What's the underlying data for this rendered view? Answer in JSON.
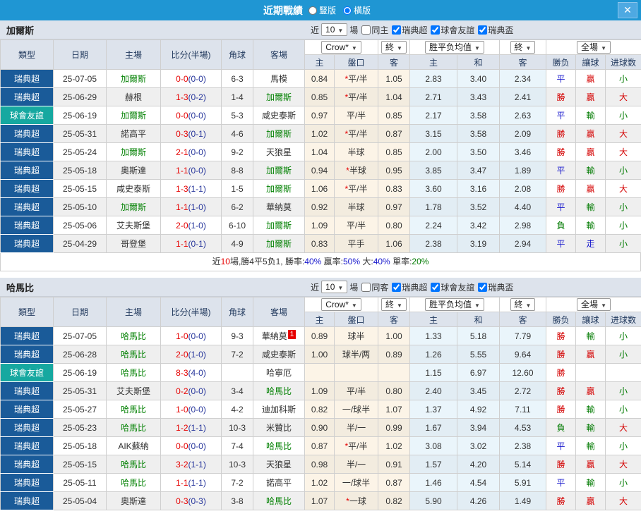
{
  "title_bar": {
    "title": "近期戰績",
    "vertical_label": "豎版",
    "vertical_selected": false,
    "horizontal_label": "橫版",
    "horizontal_selected": true,
    "close_label": "✕"
  },
  "table_header": {
    "left_columns": [
      "類型",
      "日期",
      "主場",
      "比分(半場)",
      "角球",
      "客場"
    ],
    "odds_company_dropdown": "Crow*",
    "final_dropdown_1": "終",
    "avg_dropdown": "胜平负均值",
    "final_dropdown_2": "終",
    "scope_dropdown": "全場",
    "odds_sub": [
      "主",
      "盤口",
      "客"
    ],
    "avg_sub": [
      "主",
      "和",
      "客"
    ],
    "result_sub": [
      "勝负",
      "讓球",
      "进球数"
    ]
  },
  "colors": {
    "titlebar": "#1f96d3",
    "league": {
      "瑞典超": "#1a5b99",
      "球會友誼": "#16a8a0"
    },
    "result": {
      "勝": "#d40000",
      "負": "#007a00",
      "平": "#1616cc",
      "贏": "#d40000",
      "輸": "#007a00",
      "走": "#1616cc",
      "大": "#d40000",
      "小": "#007a00"
    },
    "score_fulltime": "#e60000",
    "score_halftime": "#26359b",
    "self_team": "#008000",
    "red_card_badge": "#e60000"
  },
  "sections": [
    {
      "team": "加爾斯",
      "filter": {
        "near_label": "近",
        "count": "10",
        "games_label": "場",
        "same_label": "同主",
        "same_checked": false,
        "leagues": [
          {
            "label": "瑞典超",
            "checked": true
          },
          {
            "label": "球會友誼",
            "checked": true
          },
          {
            "label": "瑞典盃",
            "checked": true
          }
        ]
      },
      "rows": [
        {
          "type": "瑞典超",
          "date": "25-07-05",
          "home": "加爾斯",
          "home_self": true,
          "score_ft": "0-0",
          "score_ht": "(0-0)",
          "corner": "6-3",
          "away": "馬模",
          "away_self": false,
          "away_badge": "",
          "odds": {
            "home": "0.84",
            "star": "*",
            "handicap": "平/半",
            "away": "1.05"
          },
          "avg": {
            "home": "2.83",
            "draw": "3.40",
            "away": "2.34"
          },
          "result": {
            "outcome": "平",
            "handicap": "贏",
            "goals": "小"
          }
        },
        {
          "type": "瑞典超",
          "date": "25-06-29",
          "home": "赫根",
          "home_self": false,
          "score_ft": "1-3",
          "score_ht": "(0-2)",
          "corner": "1-4",
          "away": "加爾斯",
          "away_self": true,
          "away_badge": "",
          "odds": {
            "home": "0.85",
            "star": "*",
            "handicap": "平/半",
            "away": "1.04"
          },
          "avg": {
            "home": "2.71",
            "draw": "3.43",
            "away": "2.41"
          },
          "result": {
            "outcome": "勝",
            "handicap": "贏",
            "goals": "大"
          }
        },
        {
          "type": "球會友誼",
          "date": "25-06-19",
          "home": "加爾斯",
          "home_self": true,
          "score_ft": "0-0",
          "score_ht": "(0-0)",
          "corner": "5-3",
          "away": "咸史泰斯",
          "away_self": false,
          "away_badge": "",
          "odds": {
            "home": "0.97",
            "handicap": "平/半",
            "away": "0.85"
          },
          "avg": {
            "home": "2.17",
            "draw": "3.58",
            "away": "2.63"
          },
          "result": {
            "outcome": "平",
            "handicap": "輸",
            "goals": "小"
          }
        },
        {
          "type": "瑞典超",
          "date": "25-05-31",
          "home": "諾高平",
          "home_self": false,
          "score_ft": "0-3",
          "score_ht": "(0-1)",
          "corner": "4-6",
          "away": "加爾斯",
          "away_self": true,
          "away_badge": "",
          "odds": {
            "home": "1.02",
            "star": "*",
            "handicap": "平/半",
            "away": "0.87"
          },
          "avg": {
            "home": "3.15",
            "draw": "3.58",
            "away": "2.09"
          },
          "result": {
            "outcome": "勝",
            "handicap": "贏",
            "goals": "大"
          }
        },
        {
          "type": "瑞典超",
          "date": "25-05-24",
          "home": "加爾斯",
          "home_self": true,
          "score_ft": "2-1",
          "score_ht": "(0-0)",
          "corner": "9-2",
          "away": "天狼星",
          "away_self": false,
          "away_badge": "",
          "odds": {
            "home": "1.04",
            "handicap": "半球",
            "away": "0.85"
          },
          "avg": {
            "home": "2.00",
            "draw": "3.50",
            "away": "3.46"
          },
          "result": {
            "outcome": "勝",
            "handicap": "贏",
            "goals": "大"
          }
        },
        {
          "type": "瑞典超",
          "date": "25-05-18",
          "home": "奧斯達",
          "home_self": false,
          "score_ft": "1-1",
          "score_ht": "(0-0)",
          "corner": "8-8",
          "away": "加爾斯",
          "away_self": true,
          "away_badge": "",
          "odds": {
            "home": "0.94",
            "star": "*",
            "handicap": "半球",
            "away": "0.95"
          },
          "avg": {
            "home": "3.85",
            "draw": "3.47",
            "away": "1.89"
          },
          "result": {
            "outcome": "平",
            "handicap": "輸",
            "goals": "小"
          }
        },
        {
          "type": "瑞典超",
          "date": "25-05-15",
          "home": "咸史泰斯",
          "home_self": false,
          "score_ft": "1-3",
          "score_ht": "(1-1)",
          "corner": "1-5",
          "away": "加爾斯",
          "away_self": true,
          "away_badge": "",
          "odds": {
            "home": "1.06",
            "star": "*",
            "handicap": "平/半",
            "away": "0.83"
          },
          "avg": {
            "home": "3.60",
            "draw": "3.16",
            "away": "2.08"
          },
          "result": {
            "outcome": "勝",
            "handicap": "贏",
            "goals": "大"
          }
        },
        {
          "type": "瑞典超",
          "date": "25-05-10",
          "home": "加爾斯",
          "home_self": true,
          "score_ft": "1-1",
          "score_ht": "(1-0)",
          "corner": "6-2",
          "away": "華納莫",
          "away_self": false,
          "away_badge": "",
          "odds": {
            "home": "0.92",
            "handicap": "半球",
            "away": "0.97"
          },
          "avg": {
            "home": "1.78",
            "draw": "3.52",
            "away": "4.40"
          },
          "result": {
            "outcome": "平",
            "handicap": "輸",
            "goals": "小"
          }
        },
        {
          "type": "瑞典超",
          "date": "25-05-06",
          "home": "艾夫斯堡",
          "home_self": false,
          "score_ft": "2-0",
          "score_ht": "(1-0)",
          "corner": "6-10",
          "away": "加爾斯",
          "away_self": true,
          "away_badge": "",
          "odds": {
            "home": "1.09",
            "handicap": "平/半",
            "away": "0.80"
          },
          "avg": {
            "home": "2.24",
            "draw": "3.42",
            "away": "2.98"
          },
          "result": {
            "outcome": "負",
            "handicap": "輸",
            "goals": "小"
          }
        },
        {
          "type": "瑞典超",
          "date": "25-04-29",
          "home": "哥登堡",
          "home_self": false,
          "score_ft": "1-1",
          "score_ht": "(0-1)",
          "corner": "4-9",
          "away": "加爾斯",
          "away_self": true,
          "away_badge": "",
          "odds": {
            "home": "0.83",
            "handicap": "平手",
            "away": "1.06"
          },
          "avg": {
            "home": "2.38",
            "draw": "3.19",
            "away": "2.94"
          },
          "result": {
            "outcome": "平",
            "handicap": "走",
            "goals": "小"
          }
        }
      ],
      "summary": [
        {
          "text": "近",
          "color": "#333333"
        },
        {
          "text": "10",
          "color": "#e60000"
        },
        {
          "text": "場,勝4平5负1, 勝率:",
          "color": "#333333"
        },
        {
          "text": "40%",
          "color": "#1616cc"
        },
        {
          "text": " 贏率:",
          "color": "#333333"
        },
        {
          "text": "50%",
          "color": "#1616cc"
        },
        {
          "text": " 大:",
          "color": "#333333"
        },
        {
          "text": "40%",
          "color": "#1616cc"
        },
        {
          "text": " 單率:",
          "color": "#333333"
        },
        {
          "text": "20%",
          "color": "#007a00"
        }
      ]
    },
    {
      "team": "哈馬比",
      "filter": {
        "near_label": "近",
        "count": "10",
        "games_label": "場",
        "same_label": "同客",
        "same_checked": false,
        "leagues": [
          {
            "label": "瑞典超",
            "checked": true
          },
          {
            "label": "球會友誼",
            "checked": true
          },
          {
            "label": "瑞典盃",
            "checked": true
          }
        ]
      },
      "rows": [
        {
          "type": "瑞典超",
          "date": "25-07-05",
          "home": "哈馬比",
          "home_self": true,
          "score_ft": "1-0",
          "score_ht": "(0-0)",
          "corner": "9-3",
          "away": "華納莫",
          "away_self": false,
          "away_badge": "1",
          "odds": {
            "home": "0.89",
            "handicap": "球半",
            "away": "1.00"
          },
          "avg": {
            "home": "1.33",
            "draw": "5.18",
            "away": "7.79"
          },
          "result": {
            "outcome": "勝",
            "handicap": "輸",
            "goals": "小"
          }
        },
        {
          "type": "瑞典超",
          "date": "25-06-28",
          "home": "哈馬比",
          "home_self": true,
          "score_ft": "2-0",
          "score_ht": "(1-0)",
          "corner": "7-2",
          "away": "咸史泰斯",
          "away_self": false,
          "away_badge": "",
          "odds": {
            "home": "1.00",
            "handicap": "球半/两",
            "away": "0.89"
          },
          "avg": {
            "home": "1.26",
            "draw": "5.55",
            "away": "9.64"
          },
          "result": {
            "outcome": "勝",
            "handicap": "贏",
            "goals": "小"
          }
        },
        {
          "type": "球會友誼",
          "date": "25-06-19",
          "home": "哈馬比",
          "home_self": true,
          "score_ft": "8-3",
          "score_ht": "(4-0)",
          "corner": "",
          "away": "哈寧厄",
          "away_self": false,
          "away_badge": "",
          "odds": {
            "home": "",
            "handicap": "",
            "away": ""
          },
          "avg": {
            "home": "1.15",
            "draw": "6.97",
            "away": "12.60"
          },
          "result": {
            "outcome": "勝",
            "handicap": "",
            "goals": ""
          }
        },
        {
          "type": "瑞典超",
          "date": "25-05-31",
          "home": "艾夫斯堡",
          "home_self": false,
          "score_ft": "0-2",
          "score_ht": "(0-0)",
          "corner": "3-4",
          "away": "哈馬比",
          "away_self": true,
          "away_badge": "",
          "odds": {
            "home": "1.09",
            "handicap": "平/半",
            "away": "0.80"
          },
          "avg": {
            "home": "2.40",
            "draw": "3.45",
            "away": "2.72"
          },
          "result": {
            "outcome": "勝",
            "handicap": "贏",
            "goals": "小"
          }
        },
        {
          "type": "瑞典超",
          "date": "25-05-27",
          "home": "哈馬比",
          "home_self": true,
          "score_ft": "1-0",
          "score_ht": "(0-0)",
          "corner": "4-2",
          "away": "迪加科斯",
          "away_self": false,
          "away_badge": "",
          "odds": {
            "home": "0.82",
            "handicap": "一/球半",
            "away": "1.07"
          },
          "avg": {
            "home": "1.37",
            "draw": "4.92",
            "away": "7.11"
          },
          "result": {
            "outcome": "勝",
            "handicap": "輸",
            "goals": "小"
          }
        },
        {
          "type": "瑞典超",
          "date": "25-05-23",
          "home": "哈馬比",
          "home_self": true,
          "score_ft": "1-2",
          "score_ht": "(1-1)",
          "corner": "10-3",
          "away": "米贊比",
          "away_self": false,
          "away_badge": "",
          "odds": {
            "home": "0.90",
            "handicap": "半/一",
            "away": "0.99"
          },
          "avg": {
            "home": "1.67",
            "draw": "3.94",
            "away": "4.53"
          },
          "result": {
            "outcome": "負",
            "handicap": "輸",
            "goals": "大"
          }
        },
        {
          "type": "瑞典超",
          "date": "25-05-18",
          "home": "AIK蘇納",
          "home_self": false,
          "score_ft": "0-0",
          "score_ht": "(0-0)",
          "corner": "7-4",
          "away": "哈馬比",
          "away_self": true,
          "away_badge": "",
          "odds": {
            "home": "0.87",
            "star": "*",
            "handicap": "平/半",
            "away": "1.02"
          },
          "avg": {
            "home": "3.08",
            "draw": "3.02",
            "away": "2.38"
          },
          "result": {
            "outcome": "平",
            "handicap": "輸",
            "goals": "小"
          }
        },
        {
          "type": "瑞典超",
          "date": "25-05-15",
          "home": "哈馬比",
          "home_self": true,
          "score_ft": "3-2",
          "score_ht": "(1-1)",
          "corner": "10-3",
          "away": "天狼星",
          "away_self": false,
          "away_badge": "",
          "odds": {
            "home": "0.98",
            "handicap": "半/一",
            "away": "0.91"
          },
          "avg": {
            "home": "1.57",
            "draw": "4.20",
            "away": "5.14"
          },
          "result": {
            "outcome": "勝",
            "handicap": "贏",
            "goals": "大"
          }
        },
        {
          "type": "瑞典超",
          "date": "25-05-11",
          "home": "哈馬比",
          "home_self": true,
          "score_ft": "1-1",
          "score_ht": "(1-1)",
          "corner": "7-2",
          "away": "諾高平",
          "away_self": false,
          "away_badge": "",
          "odds": {
            "home": "1.02",
            "handicap": "一/球半",
            "away": "0.87"
          },
          "avg": {
            "home": "1.46",
            "draw": "4.54",
            "away": "5.91"
          },
          "result": {
            "outcome": "平",
            "handicap": "輸",
            "goals": "小"
          }
        },
        {
          "type": "瑞典超",
          "date": "25-05-04",
          "home": "奧斯達",
          "home_self": false,
          "score_ft": "0-3",
          "score_ht": "(0-3)",
          "corner": "3-8",
          "away": "哈馬比",
          "away_self": true,
          "away_badge": "",
          "odds": {
            "home": "1.07",
            "star": "*",
            "handicap": "一球",
            "away": "0.82"
          },
          "avg": {
            "home": "5.90",
            "draw": "4.26",
            "away": "1.49"
          },
          "result": {
            "outcome": "勝",
            "handicap": "贏",
            "goals": "大"
          }
        }
      ]
    }
  ]
}
